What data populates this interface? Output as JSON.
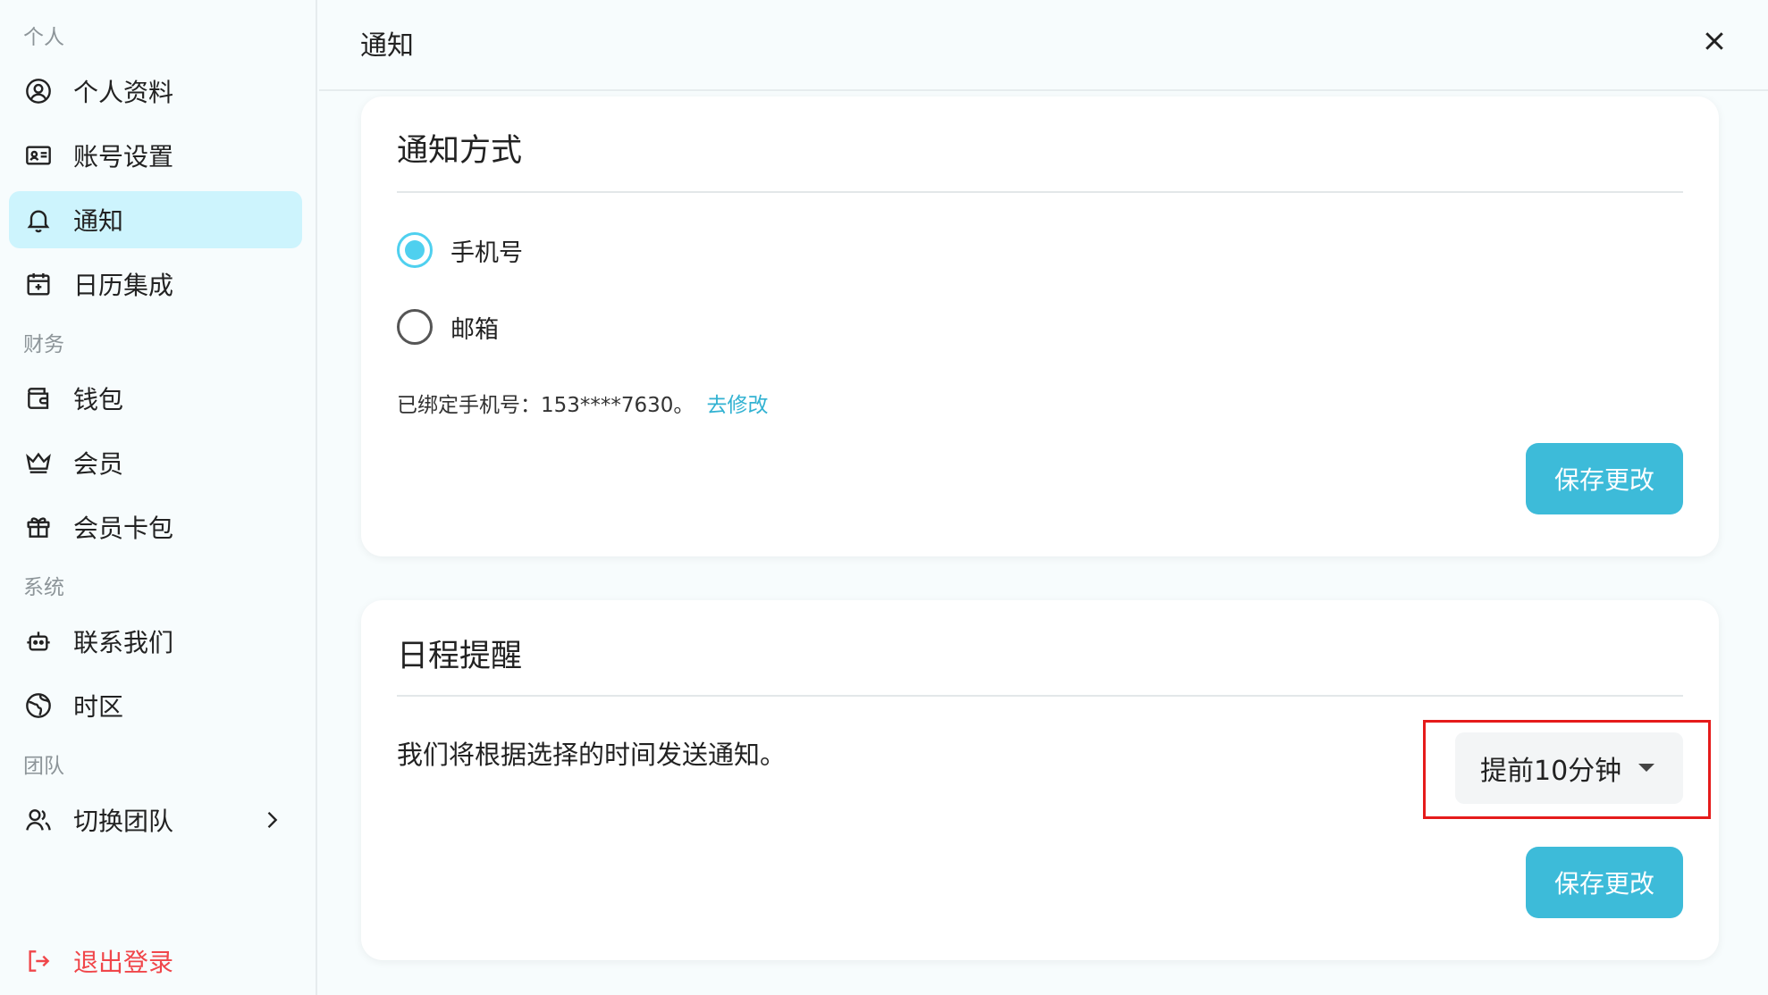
{
  "sidebar": {
    "sections": {
      "personal": "个人",
      "finance": "财务",
      "system": "系统",
      "team": "团队"
    },
    "items": [
      {
        "label": "个人资料",
        "icon": "user-circle-icon"
      },
      {
        "label": "账号设置",
        "icon": "id-card-icon"
      },
      {
        "label": "通知",
        "icon": "bell-icon",
        "active": true
      },
      {
        "label": "日历集成",
        "icon": "calendar-plus-icon"
      },
      {
        "label": "钱包",
        "icon": "wallet-icon"
      },
      {
        "label": "会员",
        "icon": "crown-icon"
      },
      {
        "label": "会员卡包",
        "icon": "gift-icon"
      },
      {
        "label": "联系我们",
        "icon": "robot-icon"
      },
      {
        "label": "时区",
        "icon": "globe-icon"
      },
      {
        "label": "切换团队",
        "icon": "users-icon"
      }
    ],
    "logout_label": "退出登录"
  },
  "header": {
    "title": "通知"
  },
  "notify_method": {
    "title": "通知方式",
    "options": [
      "手机号",
      "邮箱"
    ],
    "selected": "手机号",
    "bound_text": "已绑定手机号：153****7630。",
    "change_link": "去修改",
    "save_label": "保存更改"
  },
  "schedule_reminder": {
    "title": "日程提醒",
    "description": "我们将根据选择的时间发送通知。",
    "select_value": "提前10分钟",
    "save_label": "保存更改"
  },
  "colors": {
    "accent": "#3dbbd9",
    "active_bg": "#cdf4fd",
    "danger": "#f0464a",
    "highlight": "#e51b1b"
  }
}
